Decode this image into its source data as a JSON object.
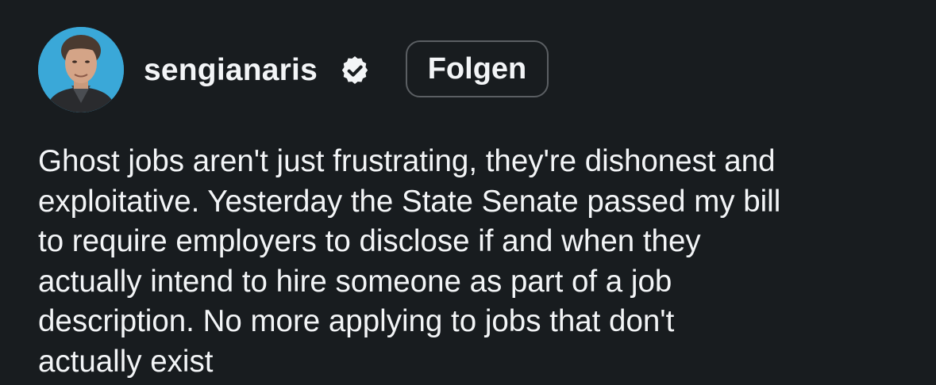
{
  "post": {
    "author": {
      "username": "sengianaris",
      "verified": true,
      "avatar_icon": "profile-photo"
    },
    "follow_label": "Folgen",
    "caption_lines": [
      "Ghost jobs aren't just frustrating, they're dishonest and",
      "exploitative. Yesterday the State Senate passed my bill",
      "to require employers to disclose if and when they",
      "actually intend to hire someone as part of a job",
      "description. No more applying to jobs that don't",
      "actually exist"
    ]
  },
  "colors": {
    "background": "#181c1f",
    "text": "#f3f5f7",
    "button_border": "#5b5f63",
    "avatar_bg": "#3aa8d8"
  }
}
